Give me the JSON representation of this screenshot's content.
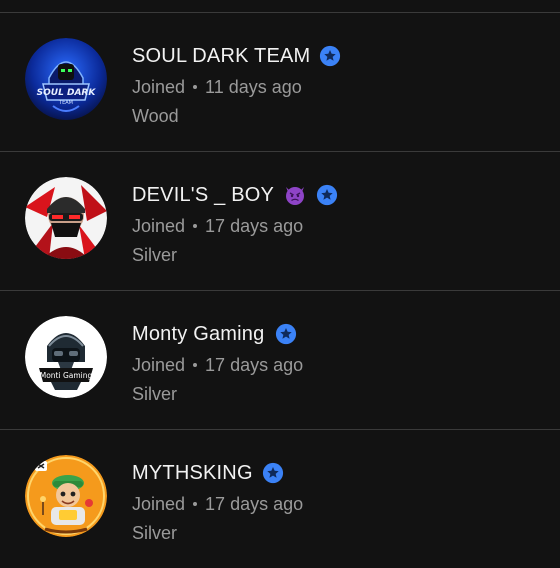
{
  "members": [
    {
      "name": "SOUL DARK TEAM",
      "joined_label": "Joined",
      "joined_ago": "11 days ago",
      "tier": "Wood",
      "avatar_icon": "soul-dark-team-logo",
      "avatar_text": "SOUL DARK",
      "avatar_subtext": "TEAM",
      "verified": true
    },
    {
      "name": "DEVIL'S _ BOY",
      "emoji_icon": "angry-devil-emoji",
      "joined_label": "Joined",
      "joined_ago": "17 days ago",
      "tier": "Silver",
      "avatar_icon": "masked-gamer-avatar",
      "verified": true
    },
    {
      "name": "Monty Gaming",
      "joined_label": "Joined",
      "joined_ago": "17 days ago",
      "tier": "Silver",
      "avatar_icon": "monty-gaming-logo",
      "avatar_text": "Monti Gaming",
      "verified": true
    },
    {
      "name": "MYTHSKING",
      "joined_label": "Joined",
      "joined_ago": "17 days ago",
      "tier": "Silver",
      "avatar_icon": "mythsking-cartoon-avatar",
      "verified": true
    }
  ],
  "colors": {
    "background": "#121212",
    "divider": "#3a3a3a",
    "name_text": "#f2f2f2",
    "meta_text": "#9a9a9a",
    "verified_badge": "#3b82f6"
  }
}
